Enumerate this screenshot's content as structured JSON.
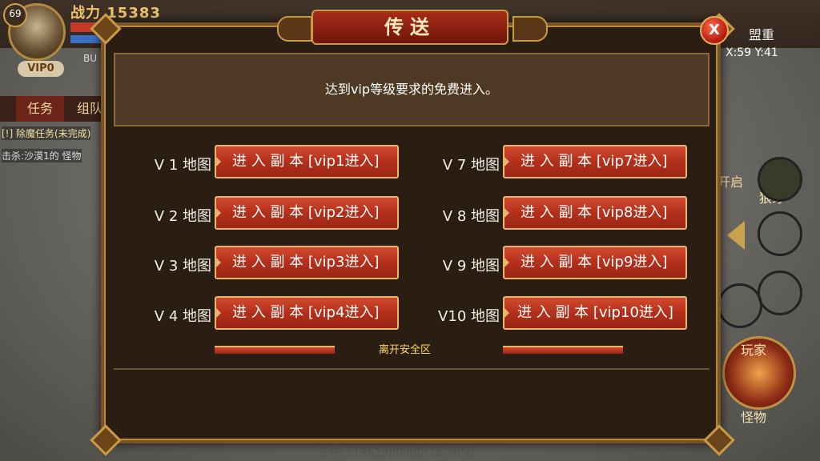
{
  "hud": {
    "level": "69",
    "vip": "VIP0",
    "power": "战力 15383",
    "bu": "BU",
    "tabs": [
      "任务",
      "组队"
    ],
    "quest_line1": "[!] 除魔任务(未完成)",
    "quest_line2": "击杀:沙漠1的 怪物",
    "map_name": "盟重",
    "coords": "X:59 Y:41",
    "open_label": "开启",
    "skill_tag": "狼牙",
    "skill_top": "玩家",
    "skill_bottom": "怪物",
    "exp_text": "EXP:11951900000(18.28%)"
  },
  "dialog": {
    "title": "传送",
    "close": "X",
    "notice": "达到vip等级要求的免费进入。",
    "leave_safe_zone": "离开安全区",
    "left_rows": [
      {
        "label": "V 1 地图",
        "button": "进 入 副 本  [vip1进入]"
      },
      {
        "label": "V 2 地图",
        "button": "进 入 副 本  [vip2进入]"
      },
      {
        "label": "V 3 地图",
        "button": "进 入 副 本  [vip3进入]"
      },
      {
        "label": "V 4 地图",
        "button": "进 入 副 本  [vip4进入]"
      }
    ],
    "right_rows": [
      {
        "label": "V 7 地图",
        "button": "进 入 副 本  [vip7进入]"
      },
      {
        "label": "V 8 地图",
        "button": "进 入 副 本  [vip8进入]"
      },
      {
        "label": "V 9 地图",
        "button": "进 入 副 本  [vip9进入]"
      },
      {
        "label": "V10 地图",
        "button": "进 入 副 本  [vip10进入]"
      }
    ]
  },
  "colors": {
    "button_red": "#b3301b",
    "button_border": "#e9b56b",
    "dialog_bg": "#2a1d12",
    "accent_yellow": "#ffd95e"
  },
  "icons": [
    "close-icon",
    "left-arrow-icon",
    "corner-ornament-icon"
  ]
}
